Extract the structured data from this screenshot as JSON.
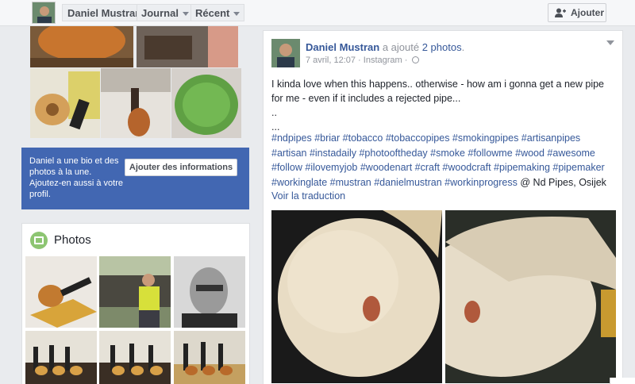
{
  "topbar": {
    "name": "Daniel Mustran",
    "journal": "Journal",
    "recent": "Récent",
    "add_button": "Ajouter",
    "icons": {
      "add": "add-friend-icon",
      "caret": "caret-down-icon"
    }
  },
  "infobox": {
    "text": "Daniel a une bio et des photos à la une. Ajoutez-en aussi à votre profil.",
    "button": "Ajouter des informations"
  },
  "photos": {
    "title": "Photos",
    "icon": "photos-icon"
  },
  "post": {
    "author": "Daniel Mustran",
    "action": "a ajouté",
    "photos_link": "2 photos",
    "punct": ".",
    "date": "7 avril, 12:07",
    "sep": "·",
    "source": "Instagram",
    "text_lines": [
      "I kinda love when this happens.. otherwise - how am i gonna get a new pipe",
      "for me - even if it includes a rejected pipe...",
      "..",
      "..."
    ],
    "tag_lines": [
      "#ndpipes #briar #tobacco #tobaccopipes #smokingpipes #artisanpipes",
      "#artisan #instadaily #photooftheday #smoke #followme #wood #awesome",
      "#follow #ilovemyjob #woodenart #craft #woodcraft #pipemaking #pipemaker",
      "#workinglate #mustran #danielmustran #workinprogress"
    ],
    "location": "@ Nd Pipes, Osijek",
    "translate": "Voir la traduction"
  },
  "colors": {
    "brand_blue": "#4267b2",
    "link": "#365899"
  }
}
